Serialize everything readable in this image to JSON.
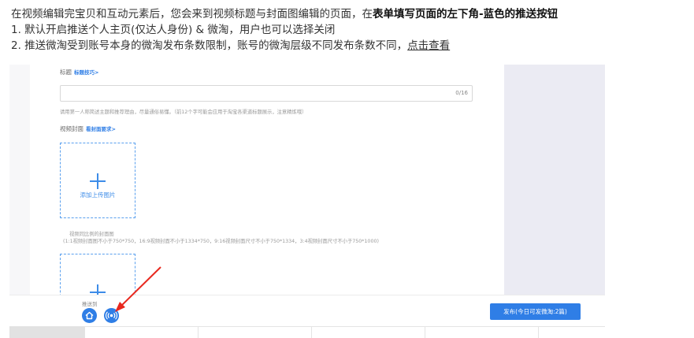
{
  "intro": {
    "line1_prefix": "在视频编辑完宝贝和互动元素后，您会来到视频标题与封面图编辑的页面，在",
    "line1_bold": "表单填写页面的左下角-蓝色的推送按钮",
    "line2": "1.  默认开启推送个人主页(仅达人身份) & 微淘，用户也可以选择关闭",
    "line3_prefix": "2. 推送微淘受到账号本身的微淘发布条数限制，账号的微淘层级不同发布条数不同，",
    "line3_link": "点击查看"
  },
  "form": {
    "title_label": "标题",
    "title_tips_link": "标题技巧>",
    "title_counter": "0/16",
    "title_hint": "请用第一人称简述主题和推荐理由，尽量通俗易懂。（前12个字可能会应用于淘宝各渠道标题展示，注意精炼哦）",
    "cover_label": "视频封面",
    "cover_req_link": "看封面要求>",
    "upload_text": "添加上传图片",
    "cover_hint_1": "视频同比例的封面图",
    "cover_hint_2": "(1:1视频封面图不小于750*750，16:9视频封面不小于1334*750，9:16视频封面尺寸不小于750*1334，3:4视频封面尺寸不小于750*1000)"
  },
  "bottom": {
    "push_to_label": "推送到",
    "publish_button": "发布(今日可发微淘:2篇)"
  },
  "icons": {
    "push_home": "home-icon",
    "push_weitao": "broadcast-icon",
    "annotation": "red-arrow-icon"
  },
  "colors": {
    "accent_blue": "#2f7ee6",
    "arrow_red": "#e8281e"
  }
}
